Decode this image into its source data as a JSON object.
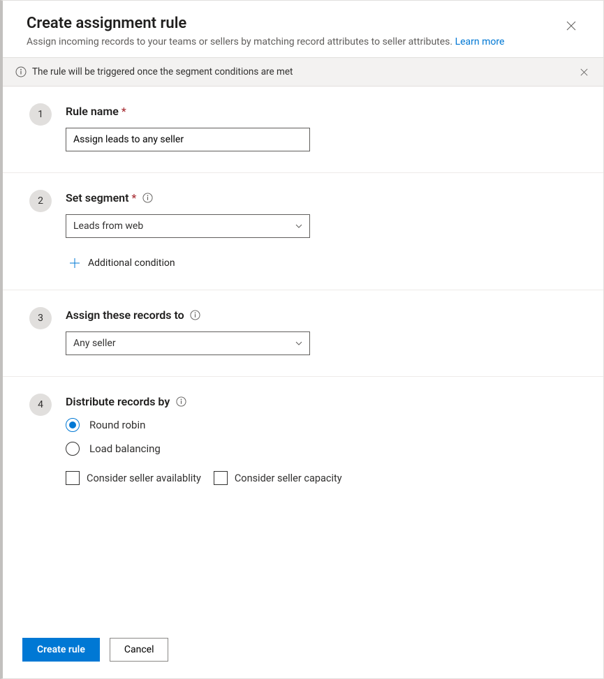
{
  "header": {
    "title": "Create assignment rule",
    "subtitle": "Assign incoming records to your teams or sellers by matching record attributes to seller attributes.",
    "learn_more": "Learn more"
  },
  "info_bar": {
    "message": "The rule will be triggered once the segment conditions are met"
  },
  "step1": {
    "number": "1",
    "label": "Rule name",
    "value": "Assign leads to any seller"
  },
  "step2": {
    "number": "2",
    "label": "Set segment",
    "value": "Leads from web",
    "add_condition": "Additional condition"
  },
  "step3": {
    "number": "3",
    "label": "Assign these records to",
    "value": "Any seller"
  },
  "step4": {
    "number": "4",
    "label": "Distribute records by",
    "option_round_robin": "Round robin",
    "option_load_balancing": "Load balancing",
    "check_availability": "Consider seller availablity",
    "check_capacity": "Consider seller capacity"
  },
  "footer": {
    "create": "Create rule",
    "cancel": "Cancel"
  }
}
